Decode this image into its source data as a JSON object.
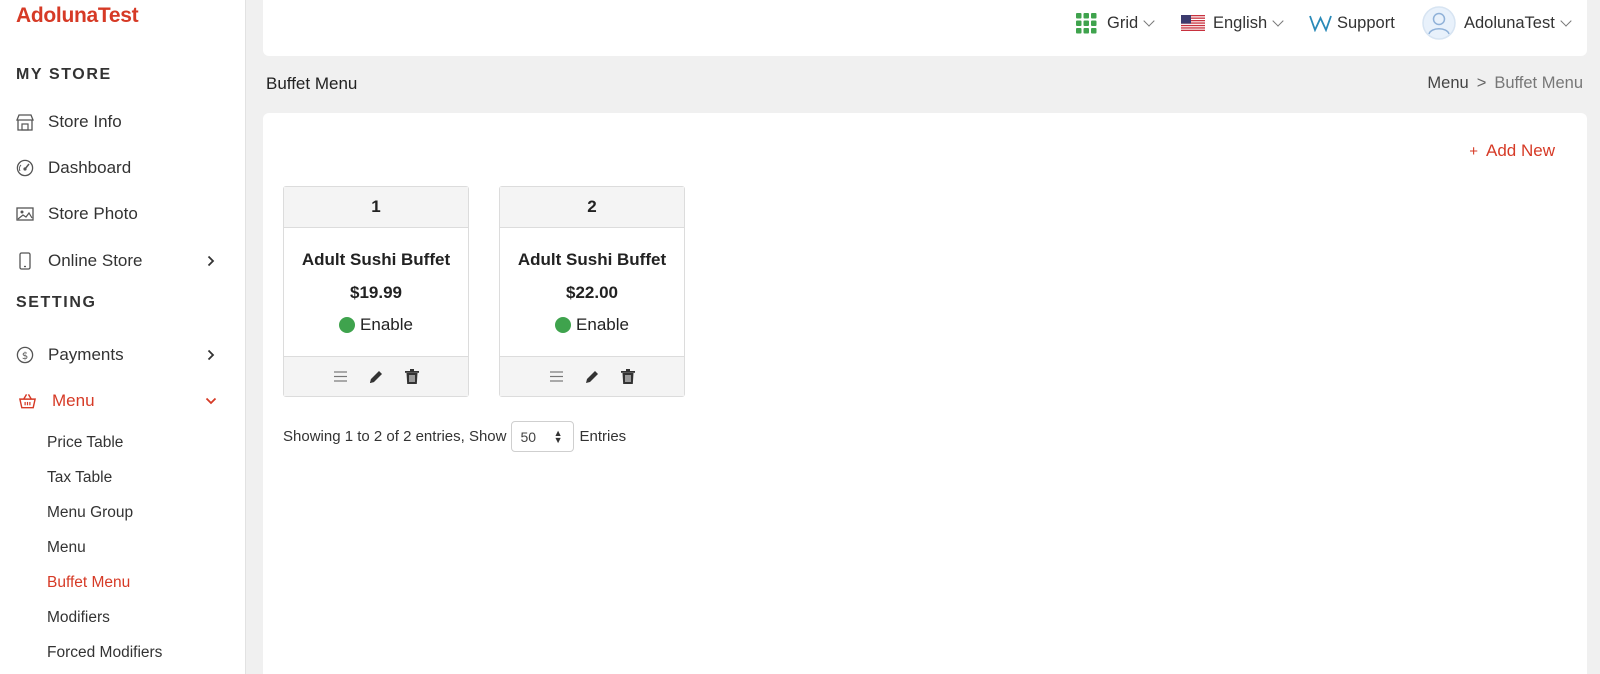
{
  "brand": "AdolunaTest",
  "sidebar": {
    "sections": [
      {
        "title": "MY STORE"
      },
      {
        "title": "SETTING"
      }
    ],
    "items": [
      {
        "label": "Store Info",
        "icon": "store-icon"
      },
      {
        "label": "Dashboard",
        "icon": "gauge-icon"
      },
      {
        "label": "Store Photo",
        "icon": "photo-icon"
      },
      {
        "label": "Online Store",
        "icon": "phone-icon",
        "chevron": "right"
      },
      {
        "label": "Payments",
        "icon": "dollar-coin-icon",
        "chevron": "right"
      },
      {
        "label": "Menu",
        "icon": "basket-icon",
        "chevron": "down",
        "active": true
      }
    ],
    "sub_items": [
      {
        "label": "Price Table"
      },
      {
        "label": "Tax Table"
      },
      {
        "label": "Menu Group"
      },
      {
        "label": "Menu"
      },
      {
        "label": "Buffet Menu",
        "active": true
      },
      {
        "label": "Modifiers"
      },
      {
        "label": "Forced Modifiers"
      }
    ]
  },
  "topbar": {
    "grid_label": "Grid",
    "language_label": "English",
    "support_label": "Support",
    "user_label": "AdolunaTest"
  },
  "page": {
    "title": "Buffet Menu",
    "breadcrumb": {
      "parent": "Menu",
      "separator": ">",
      "current": "Buffet Menu"
    }
  },
  "main": {
    "add_new_label": "Add New",
    "cards": [
      {
        "number": "1",
        "name": "Adult Sushi Buffet",
        "price": "$19.99",
        "status": "Enable"
      },
      {
        "number": "2",
        "name": "Adult Sushi Buffet",
        "price": "$22.00",
        "status": "Enable"
      }
    ],
    "pager": {
      "showing_text": "Showing 1 to 2 of 2 entries, Show",
      "page_size": "50",
      "entries_label": "Entries"
    }
  },
  "colors": {
    "accent": "#d63a26",
    "status_enabled": "#3fa34d",
    "grid_icon": "#3fa34d"
  }
}
